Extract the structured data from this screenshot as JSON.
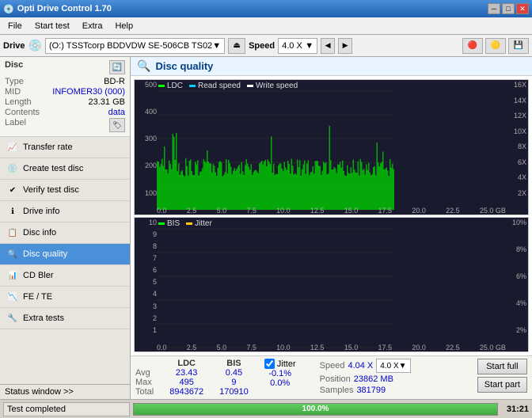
{
  "titlebar": {
    "title": "Opti Drive Control 1.70",
    "icon": "🔵"
  },
  "menubar": {
    "items": [
      "File",
      "Start test",
      "Extra",
      "Help"
    ]
  },
  "drivebar": {
    "label": "Drive",
    "drive_value": "(O:)  TSSTcorp BDDVDW SE-506CB TS02",
    "speed_label": "Speed",
    "speed_value": "4.0 X"
  },
  "disc": {
    "header": "Disc",
    "type_label": "Type",
    "type_value": "BD-R",
    "mid_label": "MID",
    "mid_value": "INFOMER30 (000)",
    "length_label": "Length",
    "length_value": "23.31 GB",
    "contents_label": "Contents",
    "contents_value": "data",
    "label_label": "Label"
  },
  "sidebar": {
    "items": [
      {
        "id": "transfer-rate",
        "label": "Transfer rate",
        "icon": "📈"
      },
      {
        "id": "create-test-disc",
        "label": "Create test disc",
        "icon": "💿"
      },
      {
        "id": "verify-test-disc",
        "label": "Verify test disc",
        "icon": "✔"
      },
      {
        "id": "drive-info",
        "label": "Drive info",
        "icon": "ℹ"
      },
      {
        "id": "disc-info",
        "label": "Disc info",
        "icon": "📋"
      },
      {
        "id": "disc-quality",
        "label": "Disc quality",
        "icon": "🔍",
        "active": true
      },
      {
        "id": "cd-bler",
        "label": "CD Bler",
        "icon": "📊"
      },
      {
        "id": "fe-te",
        "label": "FE / TE",
        "icon": "📉"
      },
      {
        "id": "extra-tests",
        "label": "Extra tests",
        "icon": "🔧"
      }
    ]
  },
  "quality": {
    "title": "Disc quality",
    "legend": {
      "ldc": "LDC",
      "read_speed": "Read speed",
      "write_speed": "Write speed",
      "bis": "BIS",
      "jitter": "Jitter"
    },
    "chart1": {
      "ymax": "500",
      "yvals": [
        "500",
        "400",
        "300",
        "200",
        "100"
      ],
      "yvals_right": [
        "16X",
        "14X",
        "12X",
        "10X",
        "8X",
        "6X",
        "4X",
        "2X"
      ],
      "xvals": [
        "0.0",
        "2.5",
        "5.0",
        "7.5",
        "10.0",
        "12.5",
        "15.0",
        "17.5",
        "20.0",
        "22.5",
        "25.0 GB"
      ]
    },
    "chart2": {
      "ymax": "10",
      "yvals": [
        "10",
        "9",
        "8",
        "7",
        "6",
        "5",
        "4",
        "3",
        "2",
        "1"
      ],
      "yvals_right": [
        "10%",
        "8%",
        "6%",
        "4%",
        "2%"
      ],
      "xvals": [
        "0.0",
        "2.5",
        "5.0",
        "7.5",
        "10.0",
        "12.5",
        "15.0",
        "17.5",
        "20.0",
        "22.5",
        "25.0 GB"
      ]
    }
  },
  "stats": {
    "ldc_header": "LDC",
    "bis_header": "BIS",
    "jitter_header": "Jitter",
    "speed_header": "Speed",
    "avg_label": "Avg",
    "max_label": "Max",
    "total_label": "Total",
    "ldc_avg": "23.43",
    "ldc_max": "495",
    "ldc_total": "8943672",
    "bis_avg": "0.45",
    "bis_max": "9",
    "bis_total": "170910",
    "jitter_avg": "-0.1%",
    "jitter_max": "0.0%",
    "jitter_total": "",
    "speed_value": "4.04 X",
    "speed_dropdown": "4.0 X",
    "position_label": "Position",
    "position_value": "23862 MB",
    "samples_label": "Samples",
    "samples_value": "381799",
    "start_full": "Start full",
    "start_part": "Start part"
  },
  "statusbar": {
    "status_window": "Status window >>",
    "test_completed": "Test completed",
    "progress": "100.0%",
    "time": "31:21"
  }
}
